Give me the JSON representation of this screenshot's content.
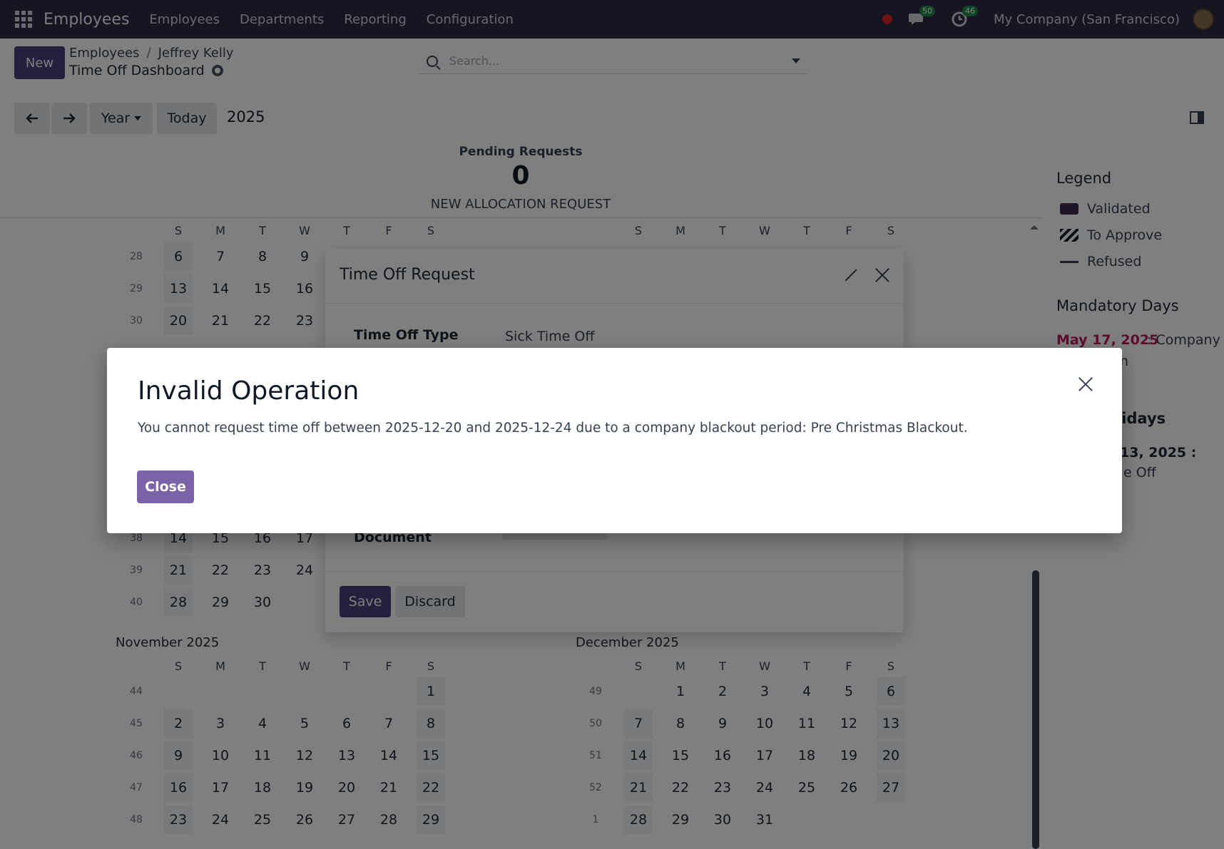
{
  "navbar": {
    "brand": "Employees",
    "menu": [
      "Employees",
      "Departments",
      "Reporting",
      "Configuration"
    ],
    "messages_badge": "50",
    "activity_badge": "46",
    "company": "My Company (San Francisco)"
  },
  "control": {
    "new_label": "New",
    "breadcrumb": [
      "Employees",
      "Jeffrey Kelly"
    ],
    "subtitle": "Time Off Dashboard",
    "search_placeholder": "Search...",
    "scale_label": "Year",
    "today_label": "Today",
    "current_year": "2025"
  },
  "dashboard": {
    "pending_title": "Pending Requests",
    "pending_count": "0",
    "new_allocation": "NEW ALLOCATION REQUEST"
  },
  "calendar": {
    "weekday_heads": [
      "S",
      "M",
      "T",
      "W",
      "T",
      "F",
      "S"
    ],
    "top_left_rows": [
      {
        "week": "28",
        "days": [
          "6",
          "7",
          "8",
          "9"
        ]
      },
      {
        "week": "29",
        "days": [
          "13",
          "14",
          "15",
          "16"
        ]
      },
      {
        "week": "30",
        "days": [
          "20",
          "21",
          "22",
          "23"
        ]
      }
    ],
    "sep_rows": [
      {
        "week": "38",
        "days": [
          "14",
          "15",
          "16",
          "17"
        ]
      },
      {
        "week": "39",
        "days": [
          "21",
          "22",
          "23",
          "24"
        ]
      },
      {
        "week": "40",
        "days": [
          "28",
          "29",
          "30"
        ]
      }
    ],
    "november": {
      "title": "November 2025",
      "rows": [
        {
          "week": "44",
          "days": [
            "",
            "",
            "",
            "",
            "",
            "",
            "1"
          ]
        },
        {
          "week": "45",
          "days": [
            "2",
            "3",
            "4",
            "5",
            "6",
            "7",
            "8"
          ]
        },
        {
          "week": "46",
          "days": [
            "9",
            "10",
            "11",
            "12",
            "13",
            "14",
            "15"
          ]
        },
        {
          "week": "47",
          "days": [
            "16",
            "17",
            "18",
            "19",
            "20",
            "21",
            "22"
          ]
        },
        {
          "week": "48",
          "days": [
            "23",
            "24",
            "25",
            "26",
            "27",
            "28",
            "29"
          ]
        }
      ]
    },
    "december": {
      "title": "December 2025",
      "rows": [
        {
          "week": "49",
          "days": [
            "",
            "1",
            "2",
            "3",
            "4",
            "5",
            "6"
          ]
        },
        {
          "week": "50",
          "days": [
            "7",
            "8",
            "9",
            "10",
            "11",
            "12",
            "13"
          ]
        },
        {
          "week": "51",
          "days": [
            "14",
            "15",
            "16",
            "17",
            "18",
            "19",
            "20"
          ]
        },
        {
          "week": "52",
          "days": [
            "21",
            "22",
            "23",
            "24",
            "25",
            "26",
            "27"
          ]
        },
        {
          "week": "1",
          "days": [
            "28",
            "29",
            "30",
            "31",
            "",
            "",
            ""
          ]
        }
      ]
    }
  },
  "legend": {
    "title": "Legend",
    "items": [
      "Validated",
      "To Approve",
      "Refused"
    ],
    "mandatory_title": "Mandatory Days",
    "mandatory_date": "May 17, 2025",
    "mandatory_text": ": Company",
    "mandatory_text2": "n",
    "holidays_title": "lidays",
    "holiday_date": "13, 2025 :",
    "holiday_text": "e Off"
  },
  "time_off_dialog": {
    "title": "Time Off Request",
    "type_label": "Time Off Type",
    "type_value": "Sick Time Off",
    "document_label": "Document",
    "save_label": "Save",
    "discard_label": "Discard"
  },
  "error_dialog": {
    "title": "Invalid Operation",
    "message": "You cannot request time off between 2025-12-20 and 2025-12-24 due to a company blackout period: Pre Christmas Blackout.",
    "close_label": "Close"
  }
}
